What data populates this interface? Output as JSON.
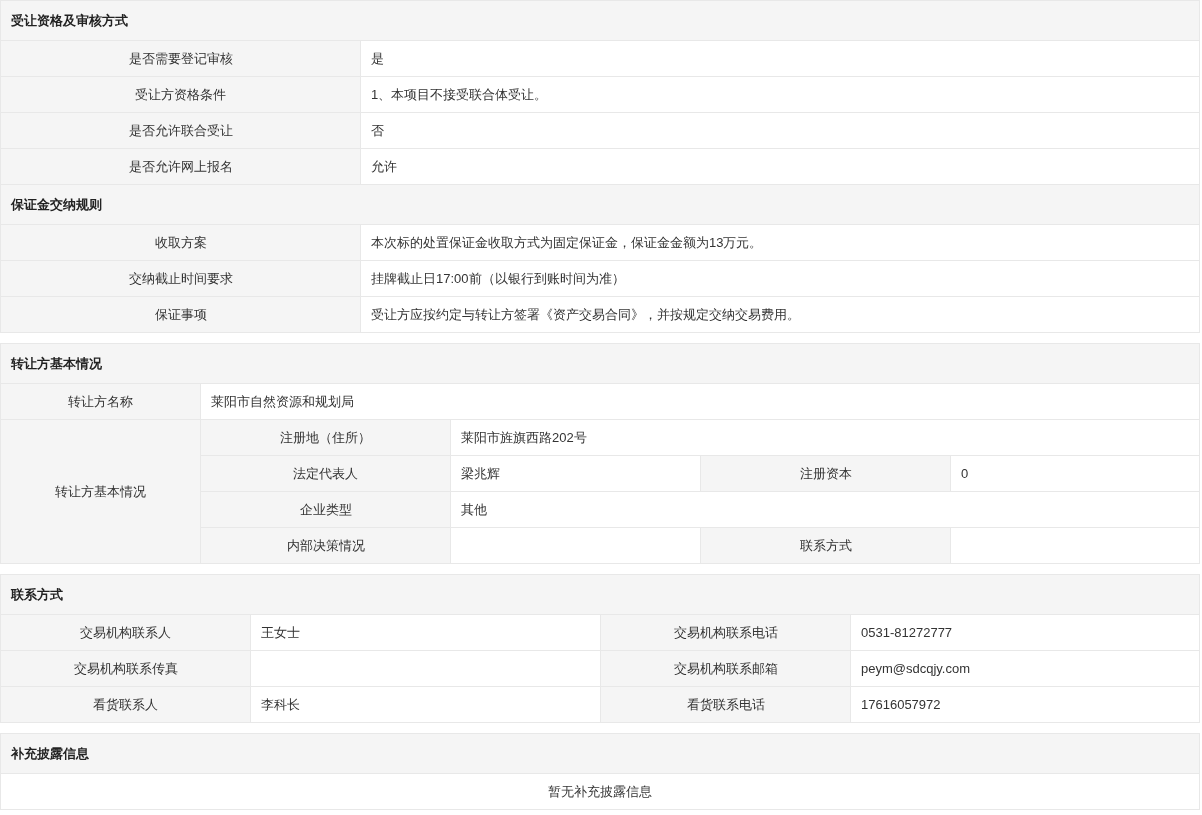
{
  "blocks": [
    {
      "sections": [
        {
          "kind": "pairs",
          "title": "受让资格及审核方式",
          "rows": [
            {
              "label": "是否需要登记审核",
              "value": "是"
            },
            {
              "label": "受让方资格条件",
              "value": "1、本项目不接受联合体受让。"
            },
            {
              "label": "是否允许联合受让",
              "value": "否"
            },
            {
              "label": "是否允许网上报名",
              "value": "允许"
            }
          ]
        },
        {
          "kind": "pairs",
          "title": "保证金交纳规则",
          "rows": [
            {
              "label": "收取方案",
              "value": "本次标的处置保证金收取方式为固定保证金，保证金金额为13万元。"
            },
            {
              "label": "交纳截止时间要求",
              "value": "挂牌截止日17:00前（以银行到账时间为准）"
            },
            {
              "label": "保证事项",
              "value": "受让方应按约定与转让方签署《资产交易合同》，并按规定交纳交易费用。"
            }
          ]
        }
      ]
    },
    {
      "sections": [
        {
          "kind": "transferor",
          "title": "转让方基本情况",
          "name": {
            "label": "转让方名称",
            "value": "莱阳市自然资源和规划局"
          },
          "details": {
            "label": "转让方基本情况",
            "fields": [
              {
                "label": "注册地（住所）",
                "value": "莱阳市旌旗西路202号",
                "wide": true
              },
              {
                "label": "法定代表人",
                "value": "梁兆辉",
                "wide": false
              },
              {
                "label": "注册资本",
                "value": "0",
                "wide": false
              },
              {
                "label": "企业类型",
                "value": "其他",
                "wide": true
              },
              {
                "label": "内部决策情况",
                "wide": false
              },
              {
                "label": "联系方式",
                "wide": false
              }
            ]
          }
        }
      ]
    },
    {
      "sections": [
        {
          "kind": "grid",
          "title": "联系方式",
          "fields": [
            {
              "label": "交易机构联系人",
              "value": "王女士"
            },
            {
              "label": "交易机构联系电话",
              "value": "0531-81272777"
            },
            {
              "label": "交易机构联系传真"
            },
            {
              "label": "交易机构联系邮箱",
              "value": "peym@sdcqjy.com"
            },
            {
              "label": "看货联系人",
              "value": "李科长"
            },
            {
              "label": "看货联系电话",
              "value": "17616057972"
            }
          ]
        }
      ]
    },
    {
      "sections": [
        {
          "kind": "notice",
          "title": "补充披露信息",
          "text": "暂无补充披露信息"
        }
      ]
    }
  ]
}
